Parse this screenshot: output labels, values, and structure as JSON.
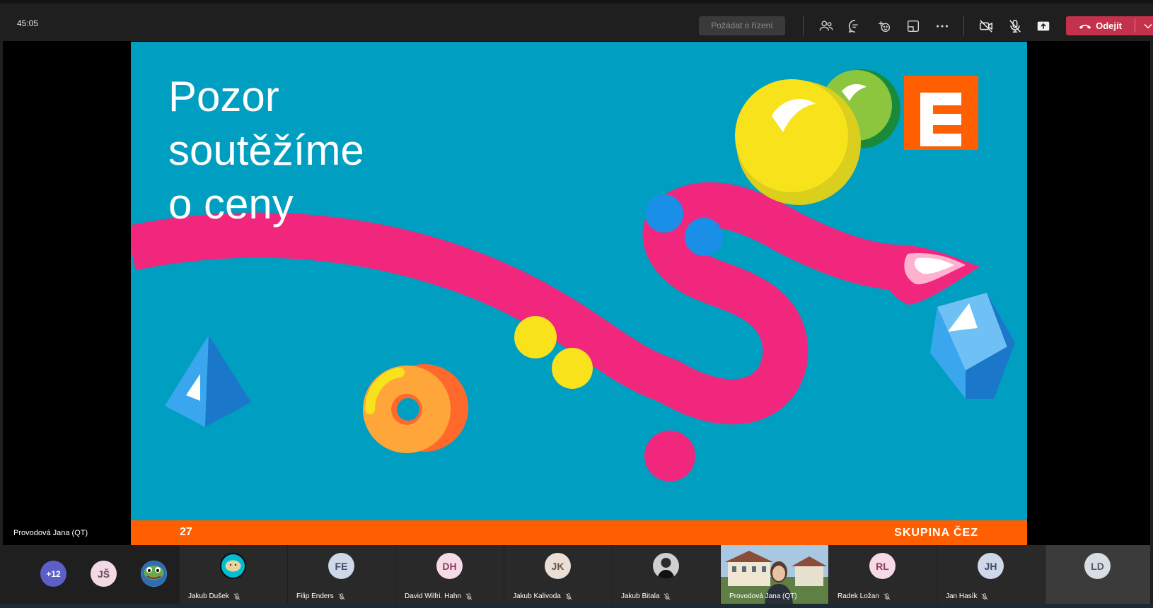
{
  "meeting": {
    "timer": "45:05",
    "request_control_label": "Požádat o řízení",
    "leave_label": "Odejít"
  },
  "toolbar_icons": [
    "participants-icon",
    "chat-icon",
    "reactions-icon",
    "rooms-icon",
    "more-icon",
    "camera-off-icon",
    "mic-off-icon",
    "share-icon"
  ],
  "slide": {
    "title_lines": [
      "Pozor",
      "soutěžíme",
      "o ceny"
    ],
    "page_number": "27",
    "brand": "SKUPINA ČEZ"
  },
  "stage": {
    "presenter_label": "Provodová Jana (QT)"
  },
  "gallery": {
    "overflow_label": "+12",
    "avatars": [
      {
        "initials": "JŠ",
        "name": "",
        "bg": "#f3d9e3",
        "fg": "#6b4b5a"
      },
      {
        "initials": "",
        "name": "",
        "bg": "#2e7d32",
        "fg": "#fff"
      }
    ],
    "tiles": [
      {
        "initials": "",
        "name": "Jakub Dušek",
        "bg": "#00bcd4",
        "fg": "#000"
      },
      {
        "initials": "FE",
        "name": "Filip Enders",
        "bg": "#cfd8e8",
        "fg": "#3b4a66"
      },
      {
        "initials": "DH",
        "name": "David Wilfri. Hahn",
        "bg": "#f6dbe6",
        "fg": "#8a3d5c"
      },
      {
        "initials": "JK",
        "name": "Jakub Kalivoda",
        "bg": "#eadfd6",
        "fg": "#6b5444"
      },
      {
        "initials": "",
        "name": "Jakub Bitala",
        "bg": "#3a3a3a",
        "fg": "#fff"
      },
      {
        "initials": "",
        "name": "Provodová Jana (QT)",
        "bg": "#6b8a5a",
        "fg": "#fff"
      },
      {
        "initials": "RL",
        "name": "Radek Ložan",
        "bg": "#f6dbe6",
        "fg": "#8a3d5c"
      },
      {
        "initials": "JH",
        "name": "Jan Hasík",
        "bg": "#cfd8e8",
        "fg": "#3b4a66"
      },
      {
        "initials": "LD",
        "name": "",
        "bg": "#d9dee2",
        "fg": "#4c5a66"
      }
    ]
  },
  "colors": {
    "slide_bg": "#009fc1",
    "accent_orange": "#ff5f00",
    "leave_red": "#c4314b",
    "pink": "#f0277d"
  }
}
